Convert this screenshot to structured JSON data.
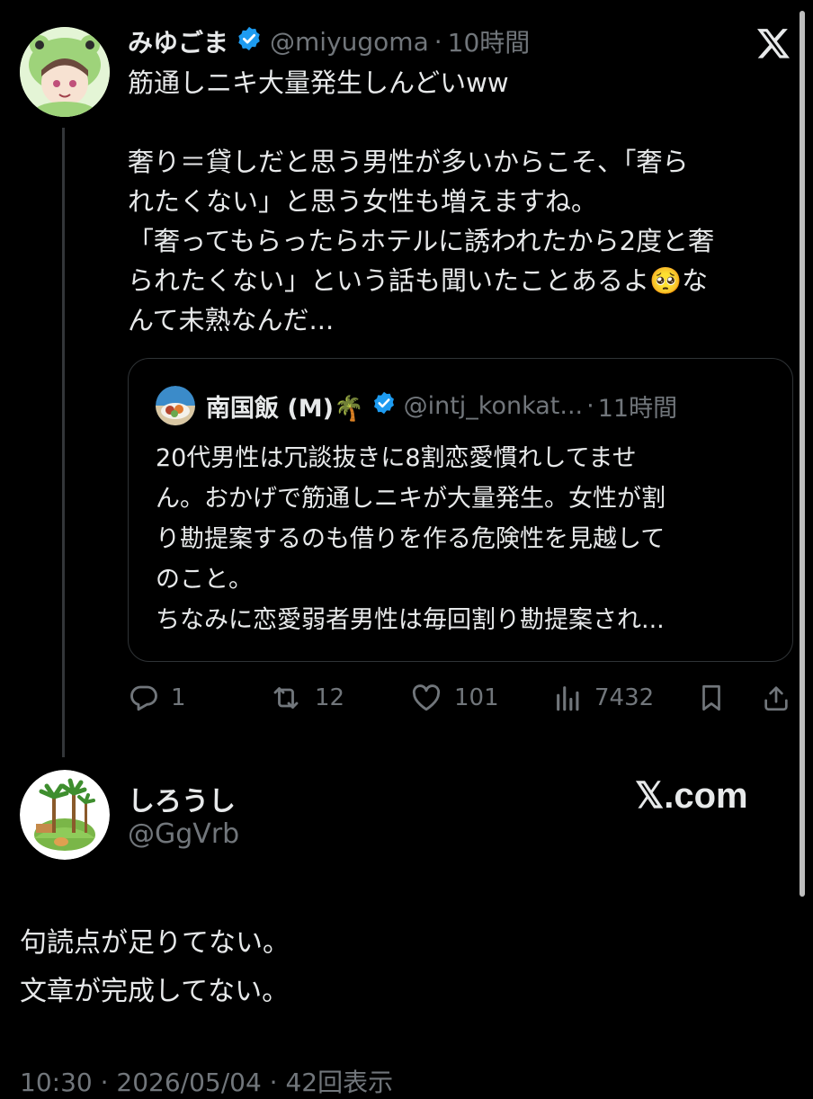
{
  "tweet1": {
    "display_name": "みゆごま",
    "handle": "@miyugoma",
    "time": "10時間",
    "text_lines": [
      "筋通しニキ大量発生しんどいww",
      "",
      "奢り＝貸しだと思う男性が多いからこそ、「奢ら",
      "れたくない」と思う女性も増えますね。",
      "「奢ってもらったらホテルに誘われたから2度と奢",
      "られたくない」という話も聞いたことあるよ🥺な",
      "んて未熟なんだ..."
    ],
    "quote": {
      "display_name": "南国飯 (M)🌴",
      "handle": "@intj_konkat...",
      "time": "11時間",
      "text_lines": [
        "20代男性は冗談抜きに8割恋愛慣れしてませ",
        "ん。おかげで筋通しニキが大量発生。女性が割",
        "り勘提案するのも借りを作る危険性を見越して",
        "のこと。",
        "ちなみに恋愛弱者男性は毎回割り勘提案され..."
      ]
    },
    "actions": {
      "replies": "1",
      "reposts": "12",
      "likes": "101",
      "views": "7432"
    },
    "platform_icon": "x-logo-icon"
  },
  "tweet2": {
    "display_name": "しろうし",
    "handle": "@GgVrb",
    "brand": "𝕏.com",
    "text_lines": [
      "句読点が足りてない。",
      "文章が完成してない。"
    ],
    "footer_partial": "10:30 · 2026/05/04 · 42回表示"
  },
  "colors": {
    "background": "#000000",
    "text": "#e7e9ea",
    "muted": "#71767b",
    "verified": "#1d9bf0",
    "border": "#2f3336"
  }
}
